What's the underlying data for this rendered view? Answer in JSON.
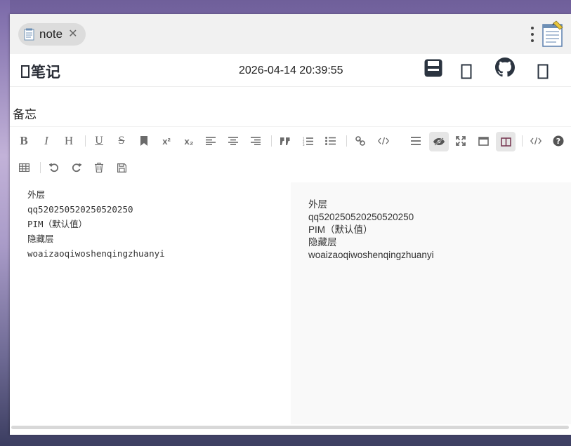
{
  "tab": {
    "label": "note",
    "close": "✕"
  },
  "header": {
    "brand": "笔记",
    "clock": "2026-04-14 20:39:55"
  },
  "note": {
    "title": "备忘"
  },
  "toolbar": {
    "bold": "B",
    "italic": "I",
    "heading": "H",
    "underline": "U",
    "strike": "S",
    "sup": "x²",
    "sub": "x₂"
  },
  "content": {
    "lines": [
      "外层",
      "qq520250520250520250",
      "PIM（默认值）",
      "隐藏层",
      "woaizaoqiwoshenqingzhuanyi"
    ]
  }
}
